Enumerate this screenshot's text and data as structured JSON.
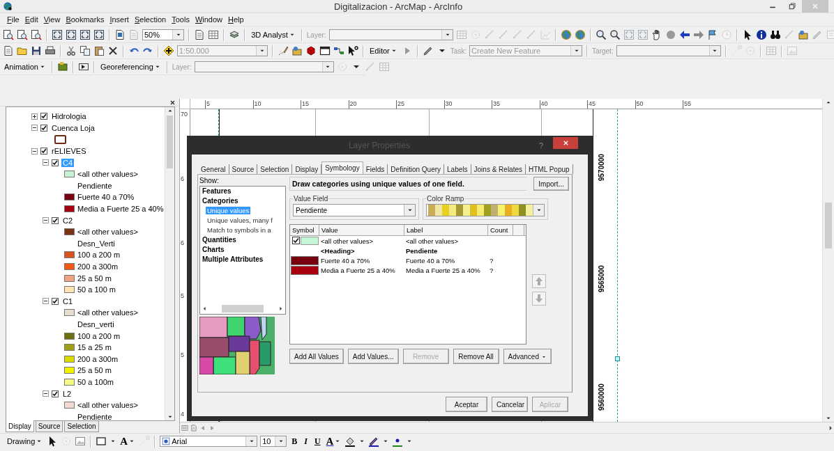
{
  "window": {
    "title": "Digitalizacion - ArcMap - ArcInfo"
  },
  "menu": [
    "File",
    "Edit",
    "View",
    "Bookmarks",
    "Insert",
    "Selection",
    "Tools",
    "Window",
    "Help"
  ],
  "toolbars": {
    "standard": {
      "zoom": "50%",
      "analyst": "3D Analyst",
      "layer_label": "Layer:"
    },
    "tools": {
      "scale": "1:50.000",
      "editor": "Editor",
      "task_label": "Task:",
      "task": "Create New Feature",
      "target_label": "Target:"
    },
    "georef": {
      "animation": "Animation",
      "georeferencing": "Georeferencing",
      "layer_label": "Layer:"
    }
  },
  "toc": {
    "layers": [
      {
        "name": "Hidrologia",
        "checked": true,
        "expanded": false,
        "selected": false
      },
      {
        "name": "Cuenca Loja",
        "checked": true,
        "expanded": true,
        "selected": false,
        "children": [
          {
            "kind": "outline",
            "color": "#6b2a14"
          }
        ]
      },
      {
        "name": "rELIEVES",
        "checked": true,
        "expanded": true,
        "selected": false,
        "children": [
          {
            "name": "C4",
            "checked": true,
            "expanded": true,
            "selected": true,
            "children": [
              {
                "kind": "swatch",
                "label": "<all other values>",
                "color": "#c8f2d2"
              },
              {
                "kind": "heading",
                "label": "Pendiente"
              },
              {
                "kind": "swatch",
                "label": "Fuerte 40 a 70%",
                "color": "#78000f"
              },
              {
                "kind": "swatch",
                "label": "Media a Fuerte 25 a 40%",
                "color": "#a8000f"
              }
            ]
          },
          {
            "name": "C2",
            "checked": true,
            "expanded": true,
            "selected": false,
            "children": [
              {
                "kind": "swatch",
                "label": "<all other values>",
                "color": "#7a3412"
              },
              {
                "kind": "heading",
                "label": "Desn_Verti"
              },
              {
                "kind": "swatch",
                "label": "100 a 200 m",
                "color": "#d9531f"
              },
              {
                "kind": "swatch",
                "label": "200 a 300m",
                "color": "#f25a12"
              },
              {
                "kind": "swatch",
                "label": "25 a 50 m",
                "color": "#f3a184"
              },
              {
                "kind": "swatch",
                "label": "50 a 100 m",
                "color": "#fde3b4"
              }
            ]
          },
          {
            "name": "C1",
            "checked": true,
            "expanded": true,
            "selected": false,
            "children": [
              {
                "kind": "swatch",
                "label": "<all other values>",
                "color": "#eadfcc"
              },
              {
                "kind": "heading",
                "label": "Desn_verti"
              },
              {
                "kind": "swatch",
                "label": "100 a 200 m",
                "color": "#6e6e12"
              },
              {
                "kind": "swatch",
                "label": "15 a 25 m",
                "color": "#a0a014"
              },
              {
                "kind": "swatch",
                "label": "200 a 300m",
                "color": "#dada00"
              },
              {
                "kind": "swatch",
                "label": "25 a 50 m",
                "color": "#f2f200"
              },
              {
                "kind": "swatch",
                "label": "50 a 100m",
                "color": "#f8f884"
              }
            ]
          },
          {
            "name": "L2",
            "checked": true,
            "expanded": true,
            "selected": false,
            "children": [
              {
                "kind": "swatch",
                "label": "<all other values>",
                "color": "#f1dad2"
              },
              {
                "kind": "heading",
                "label": "Pendiente"
              }
            ]
          }
        ]
      }
    ],
    "tabs": [
      {
        "label": "Display",
        "selected": true
      },
      {
        "label": "Source",
        "selected": false
      },
      {
        "label": "Selection",
        "selected": false
      }
    ]
  },
  "map": {
    "top_ruler": [
      "5",
      "10",
      "15",
      "20",
      "25",
      "30",
      "35",
      "40",
      "45",
      "50",
      "55"
    ],
    "left_ruler": [
      "70",
      "6",
      "6",
      "5",
      "5",
      "4"
    ],
    "y_labels": [
      "9570000",
      "9565000",
      "9560000"
    ]
  },
  "dialog": {
    "title": "Layer Properties",
    "help": "?",
    "tabs": [
      {
        "label": "General",
        "selected": false
      },
      {
        "label": "Source",
        "selected": false
      },
      {
        "label": "Selection",
        "selected": false
      },
      {
        "label": "Display",
        "selected": false
      },
      {
        "label": "Symbology",
        "selected": true
      },
      {
        "label": "Fields",
        "selected": false
      },
      {
        "label": "Definition Query",
        "selected": false
      },
      {
        "label": "Labels",
        "selected": false
      },
      {
        "label": "Joins & Relates",
        "selected": false
      },
      {
        "label": "HTML Popup",
        "selected": false
      }
    ],
    "show_label": "Show:",
    "show_items": [
      {
        "label": "Features",
        "kind": "group",
        "selected": false
      },
      {
        "label": "Categories",
        "kind": "group",
        "selected": false
      },
      {
        "label": "Unique values",
        "kind": "sub",
        "selected": true
      },
      {
        "label": "Unique values, many f",
        "kind": "sub",
        "selected": false
      },
      {
        "label": "Match to symbols in a",
        "kind": "sub",
        "selected": false
      },
      {
        "label": "Quantities",
        "kind": "group",
        "selected": false
      },
      {
        "label": "Charts",
        "kind": "group",
        "selected": false
      },
      {
        "label": "Multiple Attributes",
        "kind": "group",
        "selected": false
      }
    ],
    "description": "Draw categories using unique values of one field.",
    "import": "Import...",
    "value_field_label": "Value Field",
    "value_field": "Pendiente",
    "color_ramp_label": "Color Ramp",
    "columns": [
      "Symbol",
      "Value",
      "Label",
      "Count"
    ],
    "rows": [
      {
        "kind": "other",
        "checked": true,
        "color": "#c6f5d6",
        "value": "<all other values>",
        "label": "<all other values>"
      },
      {
        "kind": "heading",
        "value": "<Heading>",
        "label": "Pendiente"
      },
      {
        "kind": "value",
        "color": "#78000f",
        "value": "Fuerte 40 a 70%",
        "label": "Fuerte 40 a 70%",
        "count": "?"
      },
      {
        "kind": "value",
        "color": "#a8000f",
        "value": "Media a Fuerte 25 a 40%",
        "label": "Media a Fuerte 25 a 40%",
        "count": "?"
      }
    ],
    "actions": [
      {
        "label": "Add All Values",
        "disabled": false
      },
      {
        "label": "Add Values...",
        "disabled": false
      },
      {
        "label": "Remove",
        "disabled": true
      },
      {
        "label": "Remove All",
        "disabled": false
      },
      {
        "label": "Advanced",
        "disabled": false
      }
    ],
    "buttons": [
      {
        "label": "Aceptar",
        "disabled": false
      },
      {
        "label": "Cancelar",
        "disabled": false
      },
      {
        "label": "Aplicar",
        "disabled": true
      }
    ]
  },
  "drawing_toolbar": {
    "drawing": "Drawing",
    "text_tool": "A",
    "font": "Arial",
    "size": "10",
    "bold": "B",
    "italic": "I",
    "underline": "U",
    "font_color": "A"
  }
}
